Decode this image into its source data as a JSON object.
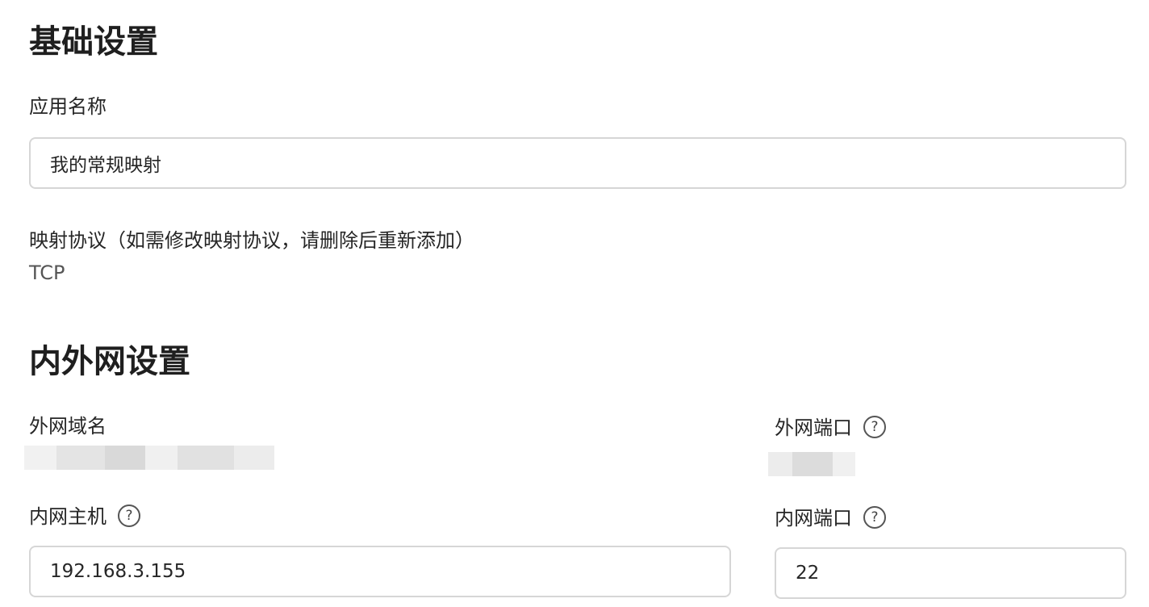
{
  "basic_settings": {
    "title": "基础设置",
    "app_name_label": "应用名称",
    "app_name_value": "我的常规映射",
    "protocol_label": "映射协议（如需修改映射协议，请删除后重新添加）",
    "protocol_value": "TCP"
  },
  "network_settings": {
    "title": "内外网设置",
    "external_domain_label": "外网域名",
    "external_port_label": "外网端口",
    "internal_host_label": "内网主机",
    "internal_host_value": "192.168.3.155",
    "internal_port_label": "内网端口",
    "internal_port_value": "22",
    "help_icon_glyph": "?"
  },
  "icons": {
    "help": "help-circle-icon"
  }
}
